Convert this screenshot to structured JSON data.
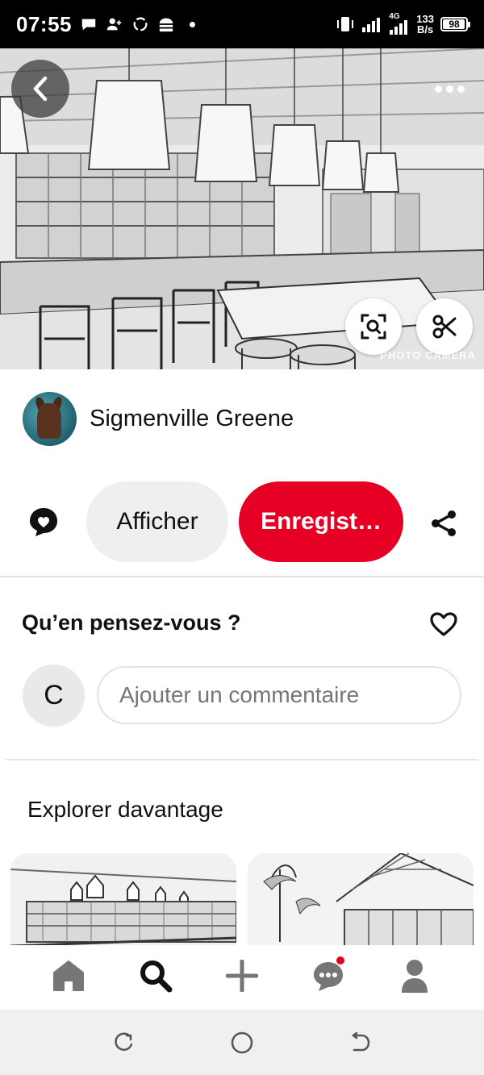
{
  "status_bar": {
    "time": "07:55",
    "net_speed_value": "133",
    "net_speed_unit": "B/s",
    "network": "4G",
    "battery": "98",
    "battery_level": 0.98
  },
  "hero": {
    "watermark": "PHOTO CAMERA"
  },
  "creator": {
    "name": "Sigmenville Greene"
  },
  "actions": {
    "view_label": "Afficher",
    "save_label": "Enregist…"
  },
  "comments": {
    "title": "Qu’en pensez-vous ?",
    "user_initial": "C",
    "input_placeholder": "Ajouter un commentaire"
  },
  "explore": {
    "title": "Explorer davantage"
  },
  "colors": {
    "brand_red": "#e60023",
    "button_gray": "#efefef",
    "text_dark": "#111111",
    "placeholder": "#767676"
  },
  "icons": {
    "back": "chevron-left-icon",
    "more": "more-dots-icon",
    "lens": "visual-search-icon",
    "cut": "scissors-icon",
    "comment": "comment-bubble-icon",
    "share": "share-icon",
    "heart": "heart-icon",
    "home": "home-icon",
    "search": "search-icon",
    "add": "plus-icon",
    "messages": "messages-icon",
    "profile": "profile-icon"
  }
}
